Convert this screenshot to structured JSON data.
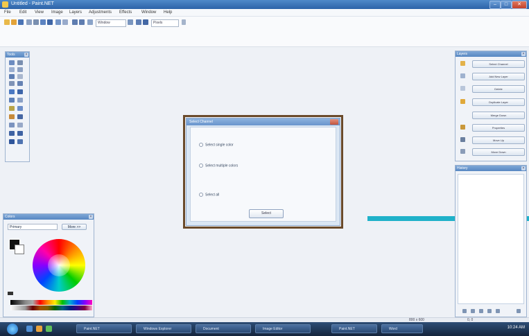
{
  "window": {
    "title": "Untitled - Paint.NET",
    "min": "–",
    "max": "□",
    "close": "✕"
  },
  "menu": [
    "File",
    "Edit",
    "View",
    "Image",
    "Layers",
    "Adjustments",
    "Effects",
    "Window",
    "Help"
  ],
  "toolbar": {
    "tool_combo": "Window",
    "units_combo": "Pixels"
  },
  "tools_panel": {
    "title": "Tools"
  },
  "colors_panel": {
    "title": "Colors",
    "mode": "Primary",
    "more_button": "More >>"
  },
  "dialog": {
    "title": "Select Channel",
    "options": [
      "Select single color",
      "Select multiple colors",
      "Select all"
    ],
    "button": "Select"
  },
  "layers_panel": {
    "title": "Layers",
    "buttons": [
      "Select Channel",
      "Add New Layer",
      "Delete",
      "Duplicate Layer",
      "Merge Down",
      "Properties",
      "Move Up",
      "Move Down"
    ]
  },
  "history_panel": {
    "title": "History"
  },
  "statusline": {
    "size": "800 x 600",
    "coords": "0, 0"
  },
  "taskbar": {
    "tasks": [
      "Paint.NET",
      "Windows Explorer",
      "Document",
      "Image Editor",
      "Paint.NET",
      "Word"
    ],
    "clock": "10:24 AM"
  },
  "colors": {
    "pointer": "#1fb1c9",
    "frame": "#6a4a2a"
  }
}
